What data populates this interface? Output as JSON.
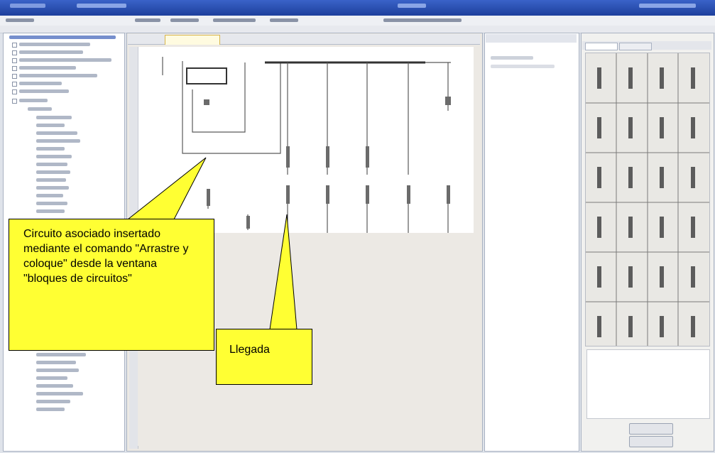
{
  "window": {
    "title_bar_text": "",
    "accent_color": "#1d3f9c"
  },
  "callouts": {
    "inserted_circuit": "Circuito asociado insertado mediante el comando \"Arrastre y coloque\" desde la ventana \"bloques de circuitos\"",
    "arrival": "Llegada",
    "fill_color": "#ffff33"
  }
}
